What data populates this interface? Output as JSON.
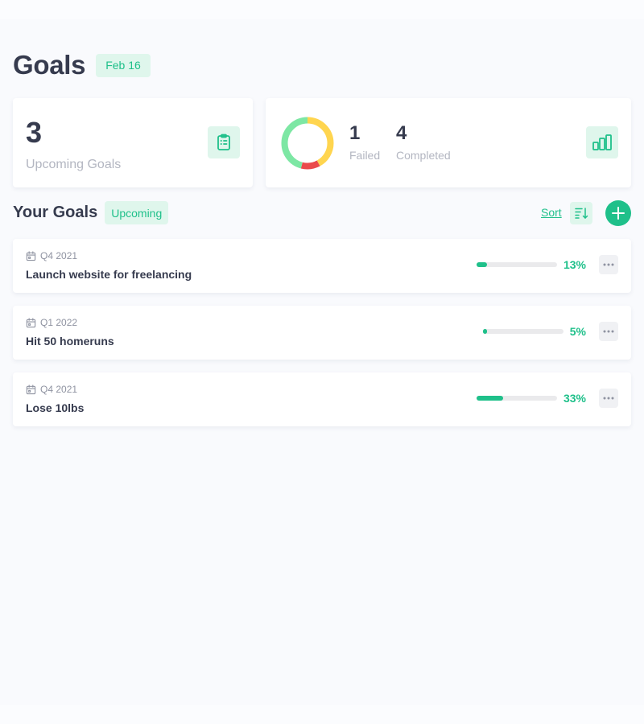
{
  "header": {
    "title": "Goals",
    "date": "Feb 16"
  },
  "summary": {
    "upcoming_count": "3",
    "upcoming_label": "Upcoming Goals",
    "failed_count": "1",
    "failed_label": "Failed",
    "completed_count": "4",
    "completed_label": "Completed"
  },
  "donut": {
    "segments": [
      {
        "value": 0.42,
        "color": "#ffd54f"
      },
      {
        "value": 0.12,
        "color": "#ea4b4b"
      },
      {
        "value": 0.46,
        "color": "#7de7a4"
      }
    ]
  },
  "goals_section": {
    "title": "Your Goals",
    "filter": "Upcoming",
    "sort_label": "Sort"
  },
  "goals": [
    {
      "period": "Q4 2021",
      "title": "Launch website for freelancing",
      "progress": 13,
      "progress_label": "13%"
    },
    {
      "period": "Q1 2022",
      "title": "Hit 50 homeruns",
      "progress": 5,
      "progress_label": "5%"
    },
    {
      "period": "Q4 2021",
      "title": "Lose 10lbs",
      "progress": 33,
      "progress_label": "33%"
    }
  ],
  "colors": {
    "accent": "#1fc08a",
    "accent_soft": "#dff6ec",
    "background": "#f9fafd"
  },
  "icons": {
    "upcoming": "clipboard-list-icon",
    "stats": "bar-chart-icon",
    "sort": "sort-descending-icon",
    "add": "plus-icon",
    "period": "calendar-icon",
    "menu": "more-horizontal-icon"
  }
}
